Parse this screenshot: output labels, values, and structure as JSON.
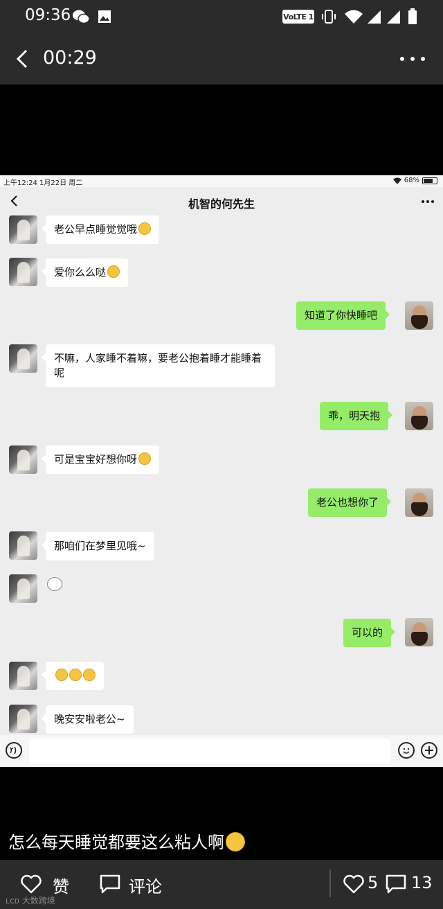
{
  "status_bar": {
    "time": "09:36",
    "volte": "VoLTE 1",
    "icons": [
      "wechat-icon",
      "image-icon",
      "vibrate-icon",
      "wifi-icon",
      "signal-icon",
      "signal-icon",
      "battery-icon"
    ]
  },
  "header": {
    "video_time": "00:29"
  },
  "inner_screenshot": {
    "status_left": "上午12:24  1月22日 周二",
    "status_right": "68%",
    "chat_title": "机智的何先生",
    "messages": [
      {
        "side": "left",
        "text": "老公早点睡觉觉哦",
        "emoji": "smile-emoji"
      },
      {
        "side": "left",
        "text": "爱你么么哒",
        "emoji": "kiss-emoji"
      },
      {
        "side": "right",
        "text": "知道了你快睡吧"
      },
      {
        "side": "left",
        "text": "不嘛，人家睡不着嘛，要老公抱着睡才能睡着呢"
      },
      {
        "side": "right",
        "text": "乖，明天抱"
      },
      {
        "side": "left",
        "text": "可是宝宝好想你呀",
        "emoji": "sad-emoji"
      },
      {
        "side": "right",
        "text": "老公也想你了"
      },
      {
        "side": "left",
        "text": "那咱们在梦里见哦~"
      },
      {
        "side": "left",
        "text": "",
        "emoji": "sticker-emoji"
      },
      {
        "side": "right",
        "text": "可以的"
      },
      {
        "side": "left",
        "text": "",
        "emoji": "kiss-emoji-x3"
      },
      {
        "side": "left",
        "text": "晚安安啦老公~"
      }
    ]
  },
  "caption": "怎么每天睡觉都要这么粘人啊",
  "bottom_bar": {
    "like_label": "赞",
    "comment_label": "评论",
    "like_count": "5",
    "comment_count": "13"
  },
  "watermark": "大数跨境"
}
